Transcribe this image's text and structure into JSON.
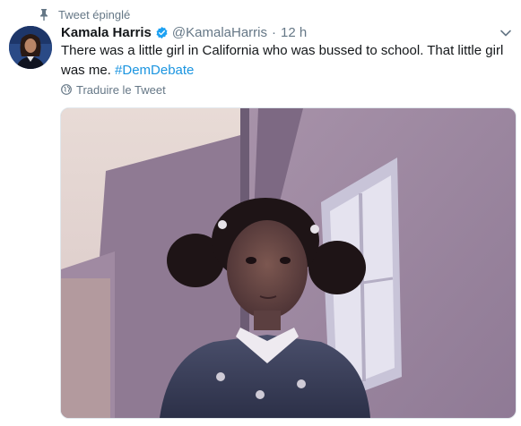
{
  "pinned": {
    "label": "Tweet épinglé",
    "icon": "pin-icon"
  },
  "author": {
    "display_name": "Kamala Harris",
    "handle": "@KamalaHarris",
    "separator": "·",
    "time": "12 h",
    "verified_icon": "verified-badge-icon",
    "avatar_icon": "avatar"
  },
  "tweet": {
    "text": "There was a little girl in California who was bussed to school. That little girl was me. ",
    "hashtag": "#DemDebate"
  },
  "translate": {
    "label": "Traduire le Tweet",
    "icon": "globe-icon"
  },
  "menu": {
    "icon": "chevron-down-icon"
  },
  "colors": {
    "text": "#14171a",
    "secondary": "#657786",
    "link": "#1b95e0",
    "verified": "#1da1f2"
  }
}
